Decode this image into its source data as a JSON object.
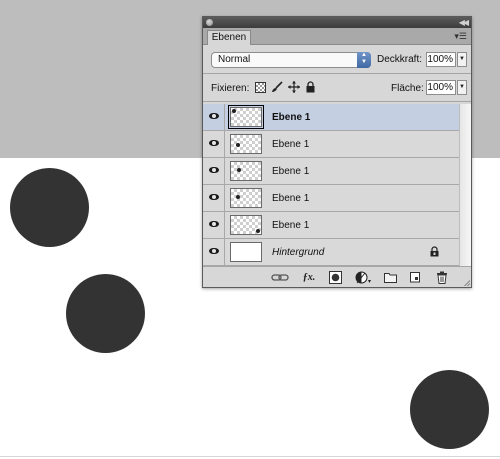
{
  "panel": {
    "tab_label": "Ebenen",
    "blend_mode": "Normal",
    "opacity_label": "Deckkraft:",
    "opacity_value": "100%",
    "lock_label": "Fixieren:",
    "fill_label": "Fläche:",
    "fill_value": "100%"
  },
  "layers": [
    {
      "name": "Ebene 1",
      "selected": true
    },
    {
      "name": "Ebene 1",
      "selected": false
    },
    {
      "name": "Ebene 1",
      "selected": false
    },
    {
      "name": "Ebene 1",
      "selected": false
    },
    {
      "name": "Ebene 1",
      "selected": false
    },
    {
      "name": "Hintergrund",
      "selected": false,
      "locked": true
    }
  ],
  "footer_icons": [
    "link-layers-icon",
    "fx-icon",
    "layer-mask-icon",
    "adjustment-layer-icon",
    "group-folder-icon",
    "new-layer-icon",
    "trash-icon"
  ],
  "colors": {
    "canvas_gray": "#bdbdbd",
    "dot": "#333333",
    "selected_row": "#c4cfe2",
    "panel_bg": "#d7d7d7"
  }
}
